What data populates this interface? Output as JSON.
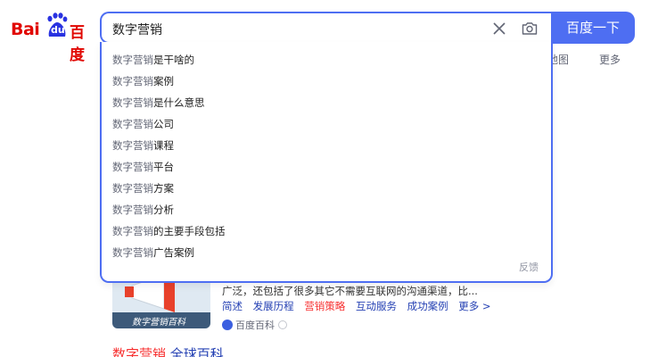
{
  "logo": {
    "text_bai": "Bai",
    "text_du": "du",
    "text_cn": "百度"
  },
  "search": {
    "query": "数字营销",
    "button_label": "百度一下"
  },
  "nav": {
    "map": "地图",
    "more": "更多"
  },
  "suggestions": [
    {
      "q": "数字营销",
      "rest": "是干啥的"
    },
    {
      "q": "数字营销",
      "rest": "案例"
    },
    {
      "q": "数字营销",
      "rest": "是什么意思"
    },
    {
      "q": "数字营销",
      "rest": "公司"
    },
    {
      "q": "数字营销",
      "rest": "课程"
    },
    {
      "q": "数字营销",
      "rest": "平台"
    },
    {
      "q": "数字营销",
      "rest": "方案"
    },
    {
      "q": "数字营销",
      "rest": "分析"
    },
    {
      "q": "数字营销",
      "rest": "的主要手段包括"
    },
    {
      "q": "数字营销",
      "rest": "广告案例"
    }
  ],
  "feedback": "反馈",
  "result": {
    "thumb_caption": "数字营销百科",
    "snippet": "广泛，还包括了很多其它不需要互联网的沟通渠道，比...",
    "links": [
      "简述",
      "发展历程",
      "营销策略",
      "互动服务",
      "成功案例",
      "更多 >"
    ],
    "source": "百度百科",
    "title_highlight": "数字营销",
    "title_rest": " 全球百科"
  }
}
